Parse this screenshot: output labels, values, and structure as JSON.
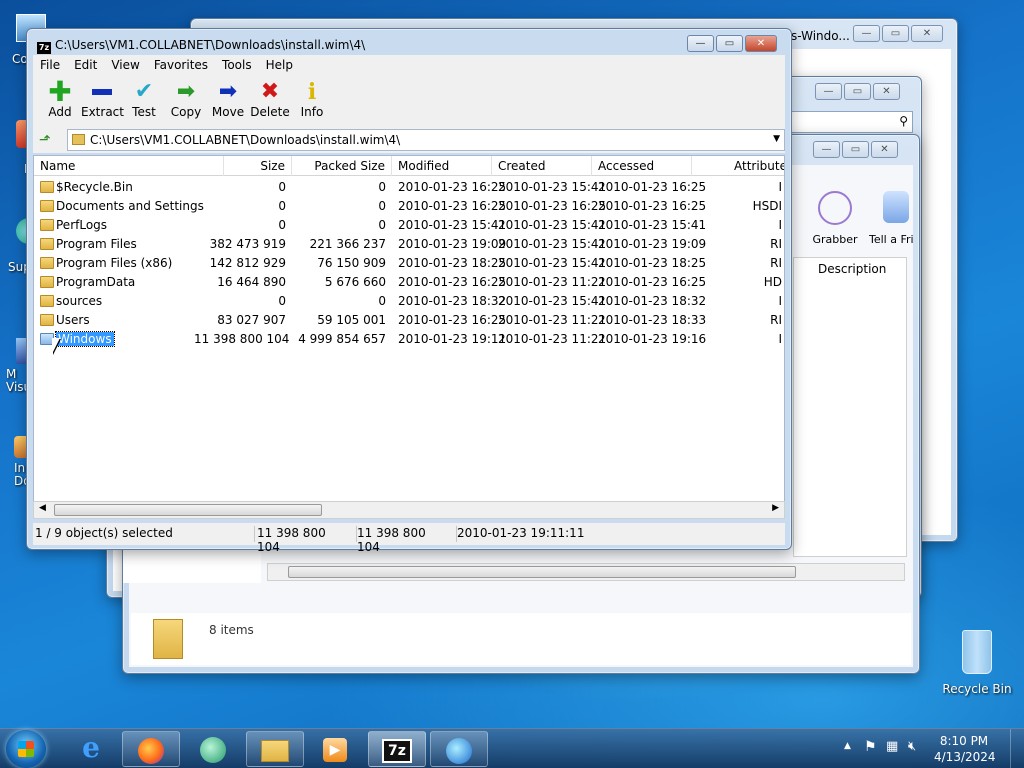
{
  "desktop": {
    "recycle_bin_label": "Recycle Bin",
    "left_icon_labels": [
      "Co",
      "F",
      "Sup",
      "M Visu",
      "In Do"
    ]
  },
  "background_windows": {
    "win1_title_fragment": "s-Windo...",
    "toolbar_labels": [
      "Grabber",
      "Tell a Fri"
    ],
    "column_header": "Description",
    "explorer_items_count": "8 items"
  },
  "main_window": {
    "title": "C:\\Users\\VM1.COLLABNET\\Downloads\\install.wim\\4\\",
    "app_badge": "7z",
    "menu": [
      "File",
      "Edit",
      "View",
      "Favorites",
      "Tools",
      "Help"
    ],
    "toolbar": [
      {
        "label": "Add",
        "icon": "plus-icon",
        "color": "#1fa51f"
      },
      {
        "label": "Extract",
        "icon": "minus-icon",
        "color": "#1030b8"
      },
      {
        "label": "Test",
        "icon": "check-icon",
        "color": "#28a8c8"
      },
      {
        "label": "Copy",
        "icon": "copy-arrow-icon",
        "color": "#2a9a2a"
      },
      {
        "label": "Move",
        "icon": "move-arrow-icon",
        "color": "#1030b8"
      },
      {
        "label": "Delete",
        "icon": "delete-x-icon",
        "color": "#d01818"
      },
      {
        "label": "Info",
        "icon": "info-icon",
        "color": "#d8b800"
      }
    ],
    "address": "C:\\Users\\VM1.COLLABNET\\Downloads\\install.wim\\4\\",
    "columns": [
      "Name",
      "Size",
      "Packed Size",
      "Modified",
      "Created",
      "Accessed",
      "Attribute"
    ],
    "rows": [
      {
        "name": "$Recycle.Bin",
        "size": "0",
        "packed": "0",
        "modified": "2010-01-23 16:25",
        "created": "2010-01-23 15:41",
        "accessed": "2010-01-23 16:25",
        "attr": "I"
      },
      {
        "name": "Documents and Settings",
        "size": "0",
        "packed": "0",
        "modified": "2010-01-23 16:25",
        "created": "2010-01-23 16:25",
        "accessed": "2010-01-23 16:25",
        "attr": "HSDI"
      },
      {
        "name": "PerfLogs",
        "size": "0",
        "packed": "0",
        "modified": "2010-01-23 15:41",
        "created": "2010-01-23 15:41",
        "accessed": "2010-01-23 15:41",
        "attr": "I"
      },
      {
        "name": "Program Files",
        "size": "382 473 919",
        "packed": "221 366 237",
        "modified": "2010-01-23 19:09",
        "created": "2010-01-23 15:41",
        "accessed": "2010-01-23 19:09",
        "attr": "RI"
      },
      {
        "name": "Program Files (x86)",
        "size": "142 812 929",
        "packed": "76 150 909",
        "modified": "2010-01-23 18:25",
        "created": "2010-01-23 15:41",
        "accessed": "2010-01-23 18:25",
        "attr": "RI"
      },
      {
        "name": "ProgramData",
        "size": "16 464 890",
        "packed": "5 676 660",
        "modified": "2010-01-23 16:25",
        "created": "2010-01-23 11:21",
        "accessed": "2010-01-23 16:25",
        "attr": "HD"
      },
      {
        "name": "sources",
        "size": "0",
        "packed": "0",
        "modified": "2010-01-23 18:32",
        "created": "2010-01-23 15:41",
        "accessed": "2010-01-23 18:32",
        "attr": "I"
      },
      {
        "name": "Users",
        "size": "83 027 907",
        "packed": "59 105 001",
        "modified": "2010-01-23 16:25",
        "created": "2010-01-23 11:21",
        "accessed": "2010-01-23 18:33",
        "attr": "RI"
      },
      {
        "name": "Windows",
        "size": "11 398 800 104",
        "packed": "4 999 854 657",
        "modified": "2010-01-23 19:11",
        "created": "2010-01-23 11:21",
        "accessed": "2010-01-23 19:16",
        "attr": "I",
        "selected": true
      }
    ],
    "status": {
      "selection": "1 / 9 object(s) selected",
      "size": "11 398 800 104",
      "packed": "11 398 800 104",
      "modified": "2010-01-23 19:11:11"
    }
  },
  "taskbar": {
    "sevenzip_label": "7z",
    "time": "8:10 PM",
    "date": "4/13/2024"
  },
  "window_controls": {
    "minimize": "—",
    "maximize": "▭",
    "close": "✕"
  }
}
